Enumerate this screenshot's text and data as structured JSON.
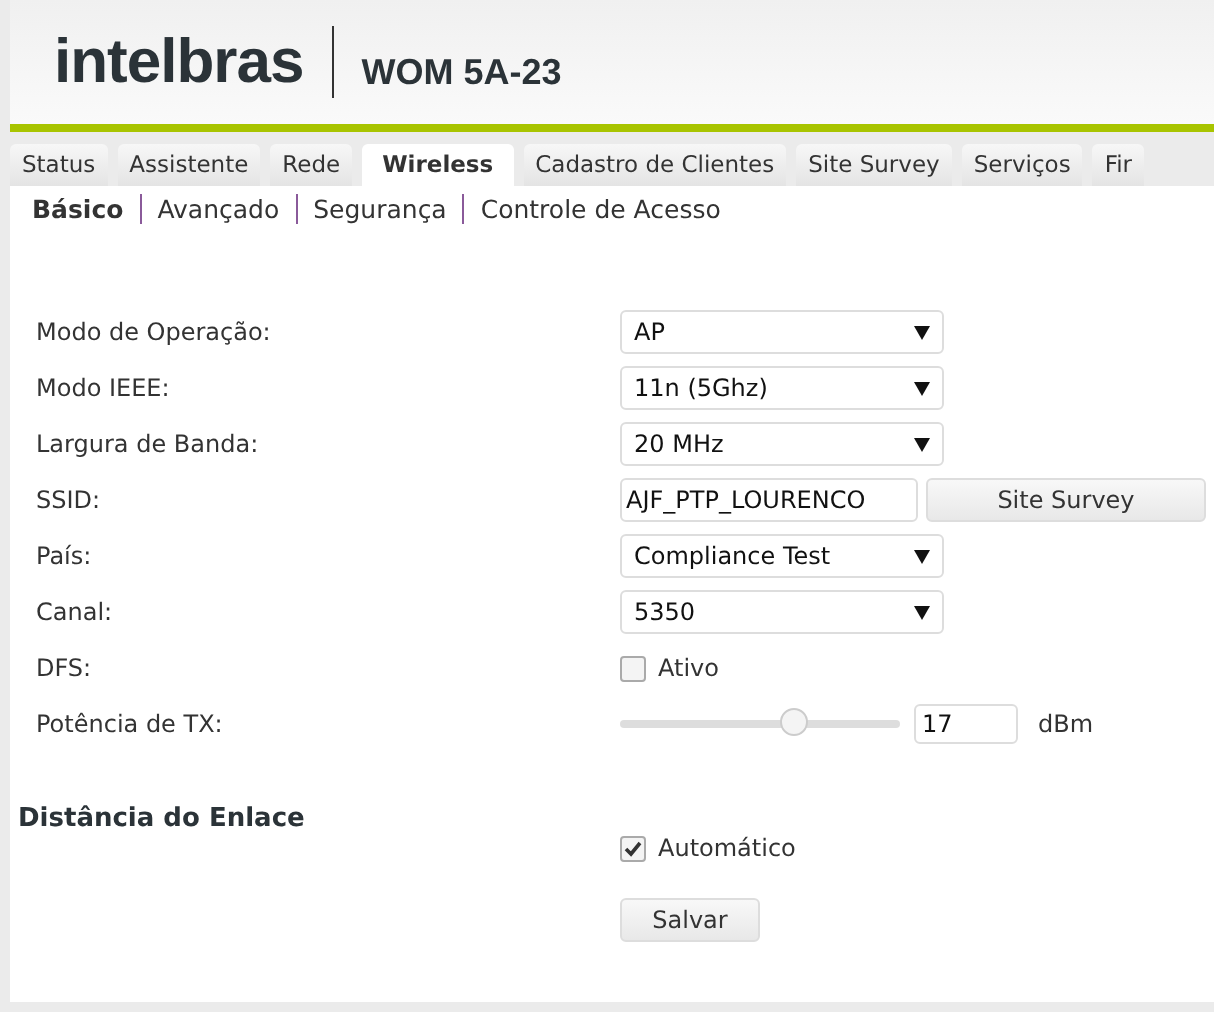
{
  "header": {
    "logo": "intelbras",
    "model": "WOM 5A-23"
  },
  "tabs": [
    {
      "label": "Status",
      "selected": false
    },
    {
      "label": "Assistente",
      "selected": false
    },
    {
      "label": "Rede",
      "selected": false
    },
    {
      "label": "Wireless",
      "selected": true
    },
    {
      "label": "Cadastro de Clientes",
      "selected": false
    },
    {
      "label": "Site Survey",
      "selected": false
    },
    {
      "label": "Serviços",
      "selected": false
    },
    {
      "label": "Fir",
      "selected": false
    }
  ],
  "subtabs": [
    {
      "label": "Básico",
      "selected": true
    },
    {
      "label": "Avançado",
      "selected": false
    },
    {
      "label": "Segurança",
      "selected": false
    },
    {
      "label": "Controle de Acesso",
      "selected": false
    }
  ],
  "fields": [
    {
      "kind": "select",
      "label": "Modo de Operação:",
      "value": "AP"
    },
    {
      "kind": "select",
      "label": "Modo IEEE:",
      "value": "11n (5Ghz)"
    },
    {
      "kind": "select",
      "label": "Largura de Banda:",
      "value": "20 MHz"
    },
    {
      "kind": "text",
      "label": "SSID:",
      "value": "AJF_PTP_LOURENCO",
      "button": "Site Survey"
    },
    {
      "kind": "select",
      "label": "País:",
      "value": "Compliance Test"
    },
    {
      "kind": "select",
      "label": "Canal:",
      "value": "5350"
    },
    {
      "kind": "checkbox",
      "label": "DFS:",
      "option": "Ativo",
      "checked": false
    },
    {
      "kind": "slider",
      "label": "Potência de TX:",
      "level": 0.62,
      "value": "17",
      "unit": "dBm"
    }
  ],
  "link_distance": {
    "title": "Distância do Enlace",
    "option": "Automático",
    "checked": true
  },
  "save_button": "Salvar"
}
